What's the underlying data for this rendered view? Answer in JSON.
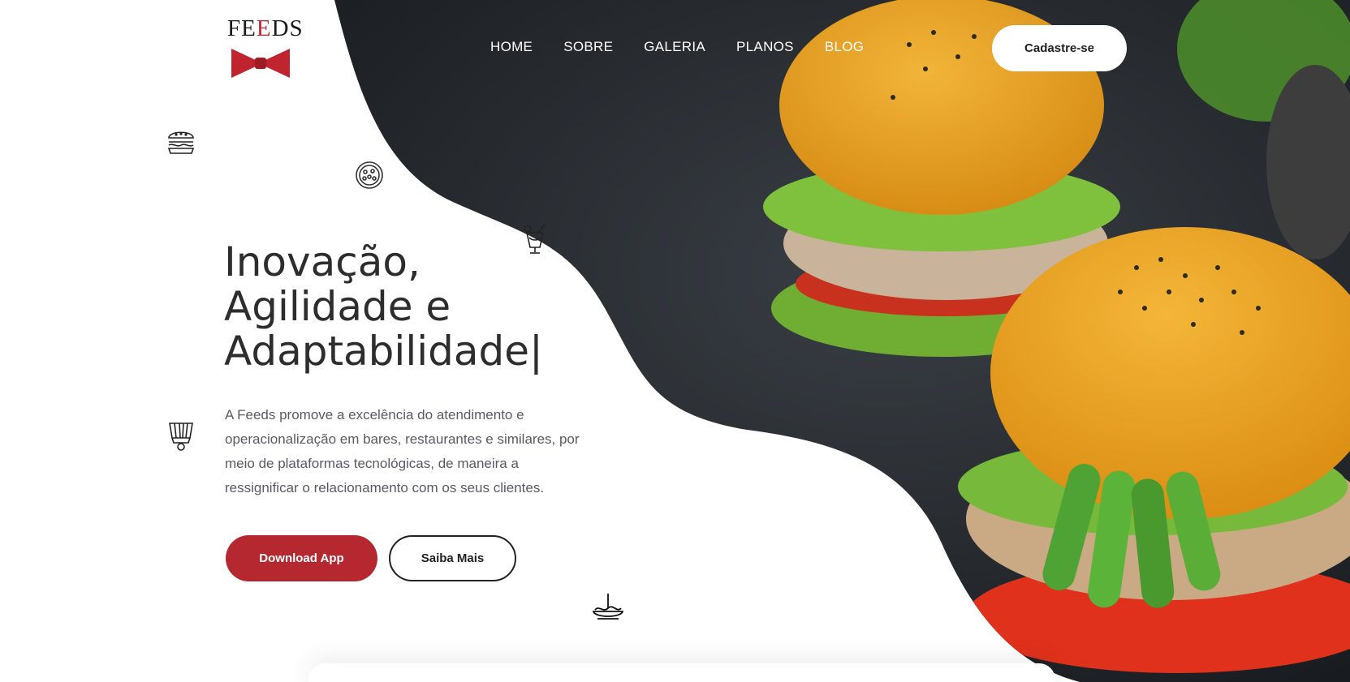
{
  "brand": {
    "logo_prefix": "FE",
    "logo_accent": "E",
    "logo_suffix": "DS",
    "accent_color": "#b5282f"
  },
  "nav": {
    "items": [
      "HOME",
      "SOBRE",
      "GALERIA",
      "PLANOS",
      "BLOG"
    ],
    "signup_label": "Cadastre-se"
  },
  "hero": {
    "headline_line1": "Inovação,",
    "headline_line2": "Agilidade e",
    "headline_line3": "Adaptabilidade",
    "caret": "|",
    "description": "A Feeds promove a excelência do atendimento e operacionalização em bares, restaurantes e similares, por meio de plataformas tecnológicas, de maneira a ressignificar o relacionamento com os seus clientes.",
    "primary_button": "Download App",
    "secondary_button": "Saiba Mais"
  },
  "icons": [
    "burger-icon",
    "pizza-icon",
    "cocktail-icon",
    "chef-hat-icon",
    "noodle-bowl-icon"
  ]
}
